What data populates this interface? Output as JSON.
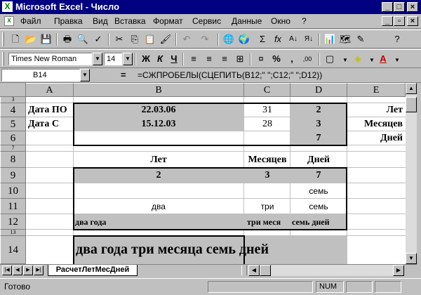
{
  "window": {
    "title": "Microsoft Excel - Число",
    "app_icon": "excel-icon"
  },
  "menu": [
    "Файл",
    "Правка",
    "Вид",
    "Вставка",
    "Формат",
    "Сервис",
    "Данные",
    "Окно",
    "?"
  ],
  "format_toolbar": {
    "font": "Times New Roman",
    "size": "14",
    "bold": "Ж",
    "italic": "К",
    "underline": "Ч",
    "percent": "%",
    "comma": ","
  },
  "formula_bar": {
    "cell_ref": "B14",
    "equals": "=",
    "formula": "=СЖПРОБЕЛЫ(СЦЕПИТЬ(B12;\" \";C12;\" \";D12))"
  },
  "columns": [
    "A",
    "B",
    "C",
    "D",
    "E"
  ],
  "rows": {
    "r3": "3",
    "r4": "4",
    "r5": "5",
    "r6": "6",
    "r7": "7",
    "r8": "8",
    "r9": "9",
    "r10": "10",
    "r11": "11",
    "r12": "12",
    "r13": "13",
    "r14": "14"
  },
  "cells": {
    "A4": "Дата ПО",
    "B4": "22.03.06",
    "C4": "31",
    "D4": "2",
    "E4": "Лет",
    "A5": "Дата С",
    "B5": "15.12.03",
    "C5": "28",
    "D5": "3",
    "E5": "Месяцев",
    "D6": "7",
    "E6": "Дней",
    "B8": "Лет",
    "C8": "Месяцев",
    "D8": "Дней",
    "B9": "2",
    "C9": "3",
    "D9": "7",
    "D10": "семь",
    "B11": "два",
    "C11": "три",
    "D11": "семь",
    "B12": "два года",
    "C12": "три меся",
    "D12": "семь дней",
    "B14": "два года три месяца семь дней"
  },
  "sheet_tab": "РасчетЛетМесДней",
  "status": {
    "ready": "Готово",
    "num": "NUM"
  },
  "colors": {
    "titlebar": "#000080",
    "chrome": "#c0c0c0",
    "cell_bg": "#ffffff",
    "gray_fill": "#c0c0c0"
  }
}
